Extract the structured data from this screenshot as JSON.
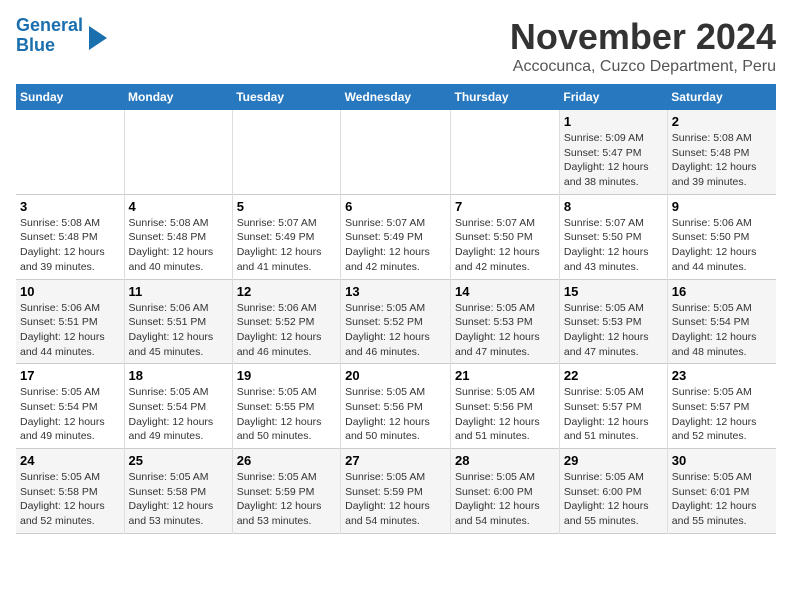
{
  "header": {
    "logo_line1": "General",
    "logo_line2": "Blue",
    "month": "November 2024",
    "location": "Accocunca, Cuzco Department, Peru"
  },
  "weekdays": [
    "Sunday",
    "Monday",
    "Tuesday",
    "Wednesday",
    "Thursday",
    "Friday",
    "Saturday"
  ],
  "weeks": [
    [
      {
        "day": "",
        "info": ""
      },
      {
        "day": "",
        "info": ""
      },
      {
        "day": "",
        "info": ""
      },
      {
        "day": "",
        "info": ""
      },
      {
        "day": "",
        "info": ""
      },
      {
        "day": "1",
        "info": "Sunrise: 5:09 AM\nSunset: 5:47 PM\nDaylight: 12 hours and 38 minutes."
      },
      {
        "day": "2",
        "info": "Sunrise: 5:08 AM\nSunset: 5:48 PM\nDaylight: 12 hours and 39 minutes."
      }
    ],
    [
      {
        "day": "3",
        "info": "Sunrise: 5:08 AM\nSunset: 5:48 PM\nDaylight: 12 hours and 39 minutes."
      },
      {
        "day": "4",
        "info": "Sunrise: 5:08 AM\nSunset: 5:48 PM\nDaylight: 12 hours and 40 minutes."
      },
      {
        "day": "5",
        "info": "Sunrise: 5:07 AM\nSunset: 5:49 PM\nDaylight: 12 hours and 41 minutes."
      },
      {
        "day": "6",
        "info": "Sunrise: 5:07 AM\nSunset: 5:49 PM\nDaylight: 12 hours and 42 minutes."
      },
      {
        "day": "7",
        "info": "Sunrise: 5:07 AM\nSunset: 5:50 PM\nDaylight: 12 hours and 42 minutes."
      },
      {
        "day": "8",
        "info": "Sunrise: 5:07 AM\nSunset: 5:50 PM\nDaylight: 12 hours and 43 minutes."
      },
      {
        "day": "9",
        "info": "Sunrise: 5:06 AM\nSunset: 5:50 PM\nDaylight: 12 hours and 44 minutes."
      }
    ],
    [
      {
        "day": "10",
        "info": "Sunrise: 5:06 AM\nSunset: 5:51 PM\nDaylight: 12 hours and 44 minutes."
      },
      {
        "day": "11",
        "info": "Sunrise: 5:06 AM\nSunset: 5:51 PM\nDaylight: 12 hours and 45 minutes."
      },
      {
        "day": "12",
        "info": "Sunrise: 5:06 AM\nSunset: 5:52 PM\nDaylight: 12 hours and 46 minutes."
      },
      {
        "day": "13",
        "info": "Sunrise: 5:05 AM\nSunset: 5:52 PM\nDaylight: 12 hours and 46 minutes."
      },
      {
        "day": "14",
        "info": "Sunrise: 5:05 AM\nSunset: 5:53 PM\nDaylight: 12 hours and 47 minutes."
      },
      {
        "day": "15",
        "info": "Sunrise: 5:05 AM\nSunset: 5:53 PM\nDaylight: 12 hours and 47 minutes."
      },
      {
        "day": "16",
        "info": "Sunrise: 5:05 AM\nSunset: 5:54 PM\nDaylight: 12 hours and 48 minutes."
      }
    ],
    [
      {
        "day": "17",
        "info": "Sunrise: 5:05 AM\nSunset: 5:54 PM\nDaylight: 12 hours and 49 minutes."
      },
      {
        "day": "18",
        "info": "Sunrise: 5:05 AM\nSunset: 5:54 PM\nDaylight: 12 hours and 49 minutes."
      },
      {
        "day": "19",
        "info": "Sunrise: 5:05 AM\nSunset: 5:55 PM\nDaylight: 12 hours and 50 minutes."
      },
      {
        "day": "20",
        "info": "Sunrise: 5:05 AM\nSunset: 5:56 PM\nDaylight: 12 hours and 50 minutes."
      },
      {
        "day": "21",
        "info": "Sunrise: 5:05 AM\nSunset: 5:56 PM\nDaylight: 12 hours and 51 minutes."
      },
      {
        "day": "22",
        "info": "Sunrise: 5:05 AM\nSunset: 5:57 PM\nDaylight: 12 hours and 51 minutes."
      },
      {
        "day": "23",
        "info": "Sunrise: 5:05 AM\nSunset: 5:57 PM\nDaylight: 12 hours and 52 minutes."
      }
    ],
    [
      {
        "day": "24",
        "info": "Sunrise: 5:05 AM\nSunset: 5:58 PM\nDaylight: 12 hours and 52 minutes."
      },
      {
        "day": "25",
        "info": "Sunrise: 5:05 AM\nSunset: 5:58 PM\nDaylight: 12 hours and 53 minutes."
      },
      {
        "day": "26",
        "info": "Sunrise: 5:05 AM\nSunset: 5:59 PM\nDaylight: 12 hours and 53 minutes."
      },
      {
        "day": "27",
        "info": "Sunrise: 5:05 AM\nSunset: 5:59 PM\nDaylight: 12 hours and 54 minutes."
      },
      {
        "day": "28",
        "info": "Sunrise: 5:05 AM\nSunset: 6:00 PM\nDaylight: 12 hours and 54 minutes."
      },
      {
        "day": "29",
        "info": "Sunrise: 5:05 AM\nSunset: 6:00 PM\nDaylight: 12 hours and 55 minutes."
      },
      {
        "day": "30",
        "info": "Sunrise: 5:05 AM\nSunset: 6:01 PM\nDaylight: 12 hours and 55 minutes."
      }
    ]
  ]
}
